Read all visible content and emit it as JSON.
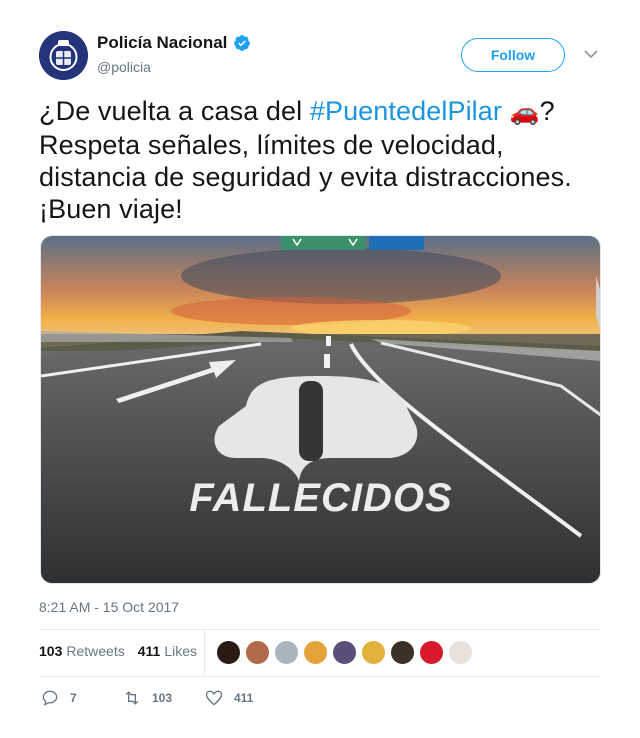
{
  "account": {
    "display_name": "Policía Nacional",
    "handle": "@policia",
    "verified": true,
    "follow_label": "Follow"
  },
  "tweet": {
    "text_before": "¿De vuelta a casa del ",
    "hashtag": "#PuentedelPilar",
    "emoji": "🚗",
    "text_after": "? Respeta señales, límites de velocidad, distancia de seguridad y evita distracciones. ¡Buen viaje!",
    "image_caption": "FALLECIDOS",
    "timestamp": "8:21 AM - 15 Oct 2017"
  },
  "stats": {
    "retweets_count": "103",
    "retweets_label": "Retweets",
    "likes_count": "411",
    "likes_label": "Likes"
  },
  "actions": {
    "reply_count": "7",
    "retweet_count": "103",
    "like_count": "411"
  },
  "colors": {
    "accent": "#1da1f2",
    "hashtag": "#1b95e0",
    "muted": "#657786"
  },
  "likers": [
    {
      "icon": "avatar-1",
      "color": "#2a1a14"
    },
    {
      "icon": "avatar-2",
      "color": "#b26b4a"
    },
    {
      "icon": "avatar-3",
      "color": "#aab4bd"
    },
    {
      "icon": "avatar-4",
      "color": "#e5a33b"
    },
    {
      "icon": "avatar-5",
      "color": "#5b4f7a"
    },
    {
      "icon": "avatar-6",
      "color": "#e2b23a"
    },
    {
      "icon": "avatar-7",
      "color": "#3b3127"
    },
    {
      "icon": "avatar-8",
      "color": "#d8182b"
    },
    {
      "icon": "avatar-9",
      "color": "#e9e2dc"
    }
  ]
}
